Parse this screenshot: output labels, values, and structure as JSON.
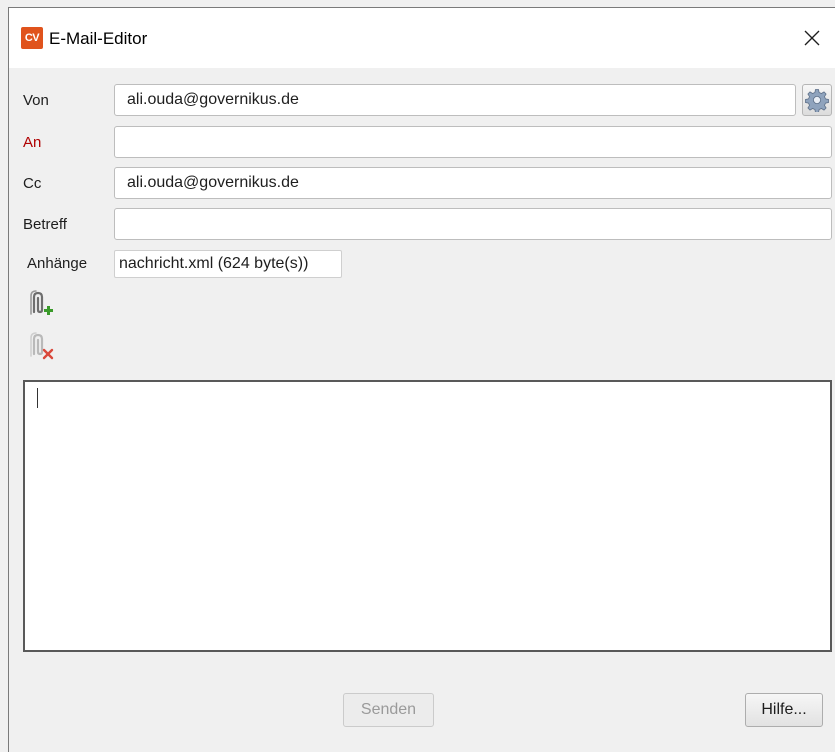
{
  "window": {
    "app_icon_text": "CV",
    "title": "E-Mail-Editor",
    "close_label": "×"
  },
  "form": {
    "from": {
      "label": "Von",
      "value": "ali.ouda@governikus.de"
    },
    "to": {
      "label": "An",
      "value": "",
      "required": true,
      "required_color": "#b00000"
    },
    "cc": {
      "label": "Cc",
      "value": "ali.ouda@governikus.de"
    },
    "subject": {
      "label": "Betreff",
      "value": ""
    },
    "attachments": {
      "label": "Anhänge",
      "items": [
        "nachricht.xml (624 byte(s))"
      ]
    }
  },
  "icons": {
    "settings": "gear-icon",
    "add_attachment": "paperclip-add-icon",
    "remove_attachment": "paperclip-remove-icon"
  },
  "body": {
    "value": ""
  },
  "buttons": {
    "send": {
      "label": "Senden",
      "enabled": false
    },
    "help": {
      "label": "Hilfe..."
    }
  },
  "colors": {
    "app_icon": "#e0531c",
    "add_green": "#3a9a2a",
    "remove_red": "#d9483b"
  }
}
